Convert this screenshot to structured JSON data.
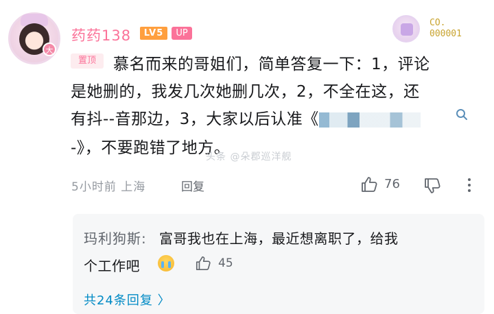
{
  "comment": {
    "username": "药药138",
    "level_badge": "LV5",
    "up_badge": "UP",
    "pin_tag": "置顶",
    "lines": [
      "慕名而来的哥姐们，简单答复一下：1，评论",
      "是她删的，我发几次她删几次，2，不全在这，还",
      "有抖--音那边，3，大家以后认准《",
      "-》，不要跑错了地方。"
    ],
    "time_location": "5小时前 上海",
    "reply_label": "回复",
    "like_count": "76",
    "watermark": "头条 @朵郡巡洋舰"
  },
  "fan_medal": {
    "text_line1": "CO.",
    "text_line2": "000001"
  },
  "sub_comment": {
    "author": "玛利狗斯:",
    "text_line1": "富哥我也在上海，最近想离职了，给我",
    "text_line2": "个工作吧",
    "emoji_icon": "crying-emoji-icon",
    "like_count": "45",
    "replies_link": "共24条回复 〉"
  },
  "colors": {
    "pink": "#fb7299",
    "level_orange": "#ff9f3e",
    "link_blue": "#008ac5",
    "gray_text": "#9499a0"
  }
}
